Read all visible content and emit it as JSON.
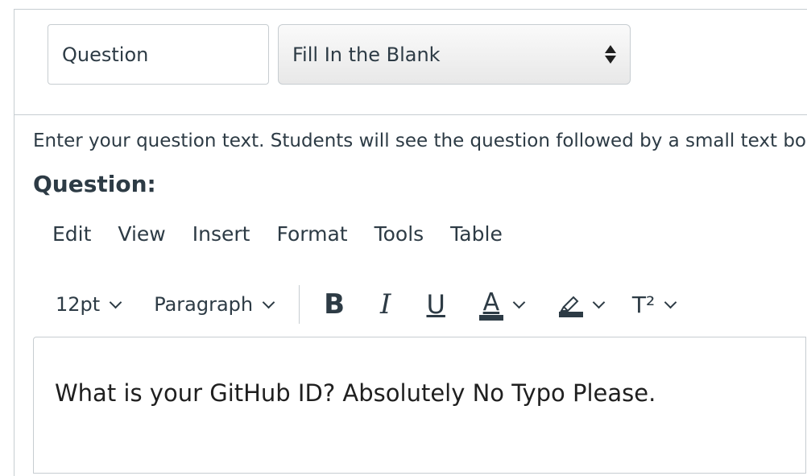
{
  "header": {
    "question_name": "Question",
    "question_type": "Fill In the Blank"
  },
  "body": {
    "instruction": "Enter your question text. Students will see the question followed by a small text box",
    "question_label": "Question:"
  },
  "editor": {
    "menu": [
      "Edit",
      "View",
      "Insert",
      "Format",
      "Tools",
      "Table"
    ],
    "font_size": "12pt",
    "block_format": "Paragraph",
    "bold": "B",
    "italic": "I",
    "underline": "U",
    "text_color": "A",
    "superscript": "T²",
    "content": "What is your GitHub ID? Absolutely No Typo Please."
  },
  "colors": {
    "border": "#c7cdd1",
    "text": "#2d3b45"
  }
}
